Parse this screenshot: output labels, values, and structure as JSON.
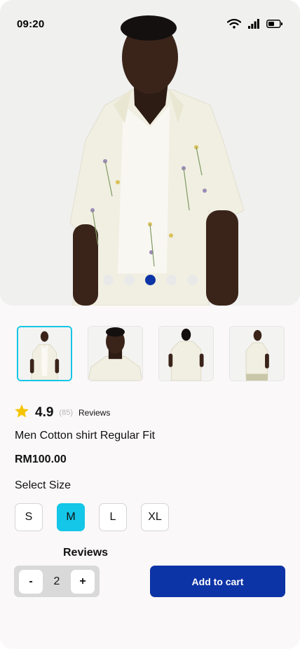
{
  "status_bar": {
    "time": "09:20",
    "icons": [
      "wifi-icon",
      "cellular-signal-icon",
      "battery-icon"
    ]
  },
  "gallery": {
    "slide_count": 5,
    "active_slide": 3,
    "thumbnails": [
      {
        "name": "thumbnail-front",
        "selected": true
      },
      {
        "name": "thumbnail-closeup",
        "selected": false
      },
      {
        "name": "thumbnail-back",
        "selected": false
      },
      {
        "name": "thumbnail-side",
        "selected": false
      }
    ]
  },
  "rating": {
    "icon": "star-icon",
    "value": "4.9",
    "count": "(85)",
    "label": "Reviews"
  },
  "product": {
    "title": "Men Cotton shirt Regular Fit",
    "price": "RM100.00"
  },
  "size_selector": {
    "label": "Select Size",
    "options": [
      "S",
      "M",
      "L",
      "XL"
    ],
    "selected": "M"
  },
  "reviews_heading": "Reviews",
  "quantity": {
    "decrement": "-",
    "value": "2",
    "increment": "+"
  },
  "add_to_cart": "Add to cart",
  "colors": {
    "primary": "#0d34a6",
    "accent": "#14c6e8",
    "star": "#f5c400"
  }
}
